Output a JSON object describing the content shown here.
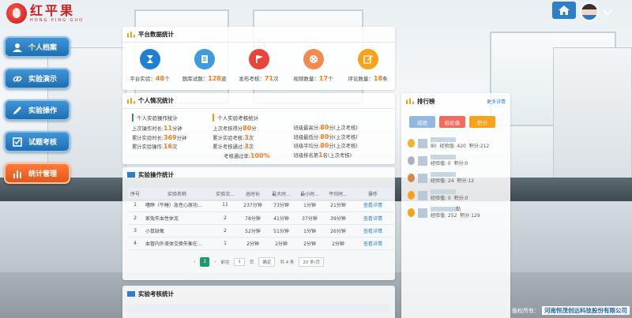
{
  "brand": {
    "name_cn": "红平果",
    "name_en": "HONG PING GUO"
  },
  "nav": [
    {
      "label": "个人档案",
      "icon": "user-icon",
      "active": false
    },
    {
      "label": "实验演示",
      "icon": "link-icon",
      "active": false
    },
    {
      "label": "实验操作",
      "icon": "pencil-icon",
      "active": false
    },
    {
      "label": "试题考核",
      "icon": "exam-icon",
      "active": false
    },
    {
      "label": "统计管理",
      "icon": "bar-chart-icon",
      "active": true
    }
  ],
  "platform": {
    "title": "平台数据统计",
    "items": [
      {
        "label": "平台实验：",
        "value": "48",
        "unit": "个",
        "icon": "hourglass-icon",
        "color": "#1e7fd4"
      },
      {
        "label": "题库试题：",
        "value": "128",
        "unit": "道",
        "icon": "document-icon",
        "color": "#3d9be0"
      },
      {
        "label": "发布考核：",
        "value": "71",
        "unit": "次",
        "icon": "flag-icon",
        "color": "#e7463b"
      },
      {
        "label": "视频数量：",
        "value": "17",
        "unit": "个",
        "icon": "film-reel-icon",
        "color": "#f58a4f"
      },
      {
        "label": "评论数量：",
        "value": "18",
        "unit": "条",
        "icon": "edit-icon",
        "color": "#f7a21b"
      }
    ]
  },
  "personal": {
    "title": "个人情况统计",
    "exp_head": "个人实验操作统计",
    "exam_head": "个人实验考核统计",
    "exp": [
      {
        "label": "上次操作时长:",
        "value": "11",
        "unit": "分钟"
      },
      {
        "label": "累计实验时长:",
        "value": "369",
        "unit": "分钟"
      },
      {
        "label": "累计实验操作:",
        "value": "16",
        "unit": "次"
      }
    ],
    "exam_left": [
      {
        "label": "上次考核得分",
        "value": "80",
        "unit": "分"
      },
      {
        "label": "累计实验考核:",
        "value": "3",
        "unit": "次"
      },
      {
        "label": "累计考核通过:",
        "value": "3",
        "unit": "次"
      },
      {
        "label": "考核通过率:",
        "value": "100%",
        "unit": ""
      }
    ],
    "exam_right": [
      {
        "label": "班级最高分:",
        "value": "80",
        "unit": "分(上次考核)"
      },
      {
        "label": "班级最低分:",
        "value": "80",
        "unit": "分(上次考核)"
      },
      {
        "label": "班级平均分:",
        "value": "80",
        "unit": "分(上次考核)"
      },
      {
        "label": "班级排名第",
        "value": "1",
        "unit": "名(上次考核)"
      }
    ]
  },
  "exp_table": {
    "title": "实验操作统计",
    "headers": [
      "序号",
      "实验名称",
      "实验次...",
      "总时长",
      "最大时...",
      "最小时...",
      "平均时...",
      "操作"
    ],
    "rows": [
      [
        "1",
        "嗜睁（午睡）急性心原功...",
        "11",
        "237分钟",
        "73分钟",
        "1分钟",
        "21分钟",
        "查看详情"
      ],
      [
        "2",
        "家兔失血性休克",
        "2",
        "78分钟",
        "41分钟",
        "37分钟",
        "39分钟",
        "查看详情"
      ],
      [
        "3",
        "小鼠缺氧",
        "2",
        "52分钟",
        "51分钟",
        "1分钟",
        "26分钟",
        "查看详情"
      ],
      [
        "4",
        "血管内外液体交换失衡在...",
        "1",
        "2分钟",
        "2分钟",
        "2分钟",
        "2分钟",
        "查看详情"
      ]
    ],
    "pager": {
      "prev": "‹",
      "current": "1",
      "next": "›",
      "goto": "前往",
      "page_input": "1",
      "page_unit": "页",
      "confirm": "确定",
      "total": "共 4 条",
      "per_page": "20 条/页"
    }
  },
  "exam_table": {
    "title": "实验考核统计"
  },
  "ranking": {
    "title": "排行榜",
    "more": "更多详情",
    "tabs": [
      {
        "label": "成绩",
        "color": "#8fb9e0"
      },
      {
        "label": "经验值",
        "color": "#f36a5c"
      },
      {
        "label": "积分",
        "color": "#f7a21b"
      }
    ],
    "items": [
      {
        "name": "80",
        "exp": "经验值: 420",
        "score": "积分:212",
        "medal": "#f2b233"
      },
      {
        "name": "",
        "exp": "经验值: 0",
        "score": "积分:0",
        "medal": "#a9b4bd"
      },
      {
        "name": "",
        "exp": "经验值: 24",
        "score": "积分:12",
        "medal": "#d48a4a"
      },
      {
        "name": "",
        "exp": "经验值: 0",
        "score": "积分:0",
        "medal": "#f7a21b"
      },
      {
        "name": "勤",
        "exp": "经验值: 252",
        "score": "积分:129",
        "medal": "#f7a21b"
      }
    ]
  },
  "footer": {
    "label": "版权所有：",
    "company": "河南恒茂创远科技股份有限公司"
  }
}
